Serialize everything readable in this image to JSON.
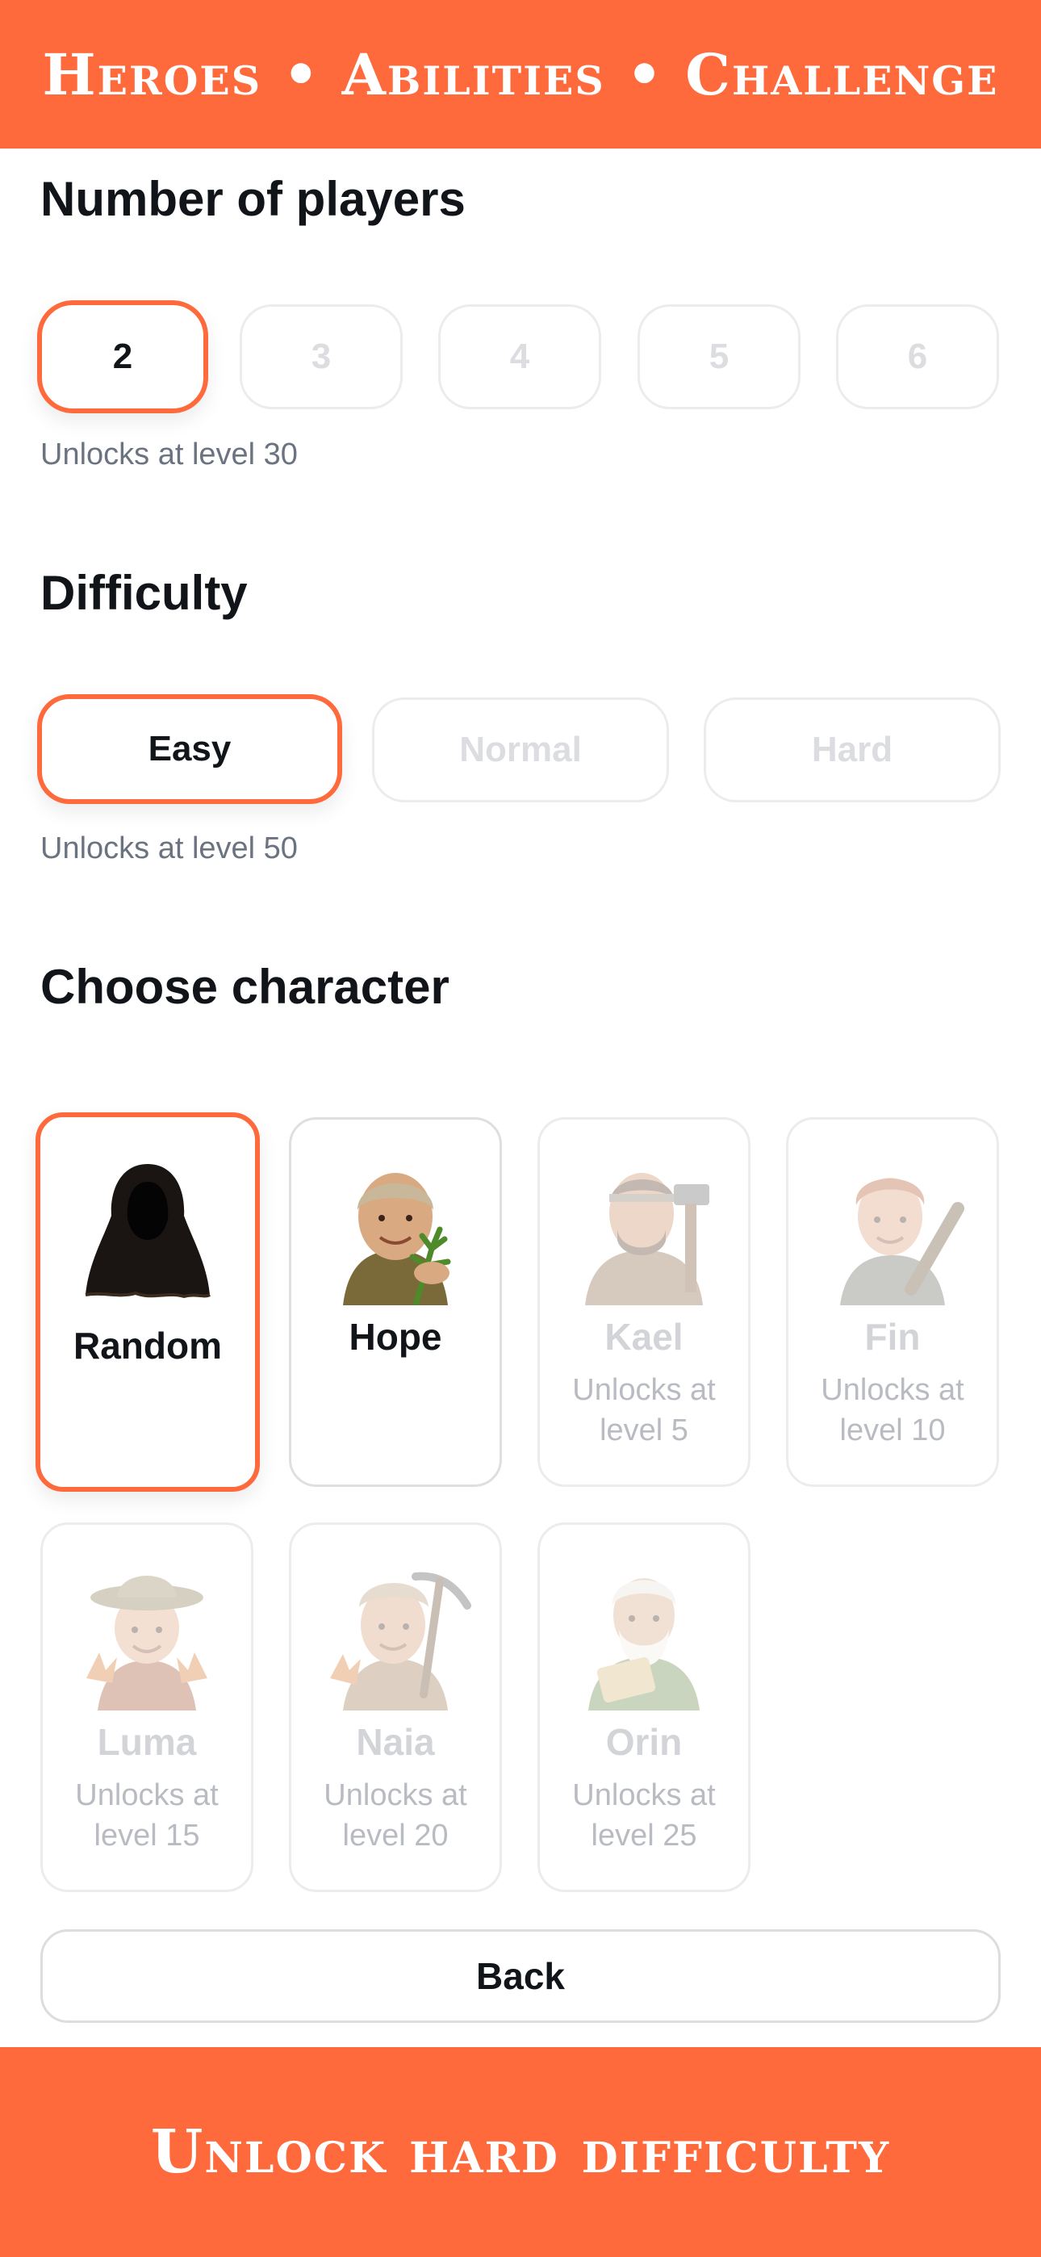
{
  "header": {
    "title": "Heroes • Abilities • Challenge"
  },
  "players": {
    "title": "Number of players",
    "options": [
      "2",
      "3",
      "4",
      "5",
      "6"
    ],
    "selected": "2",
    "hint": "Unlocks at level 30"
  },
  "difficulty": {
    "title": "Difficulty",
    "options": [
      "Easy",
      "Normal",
      "Hard"
    ],
    "selected": "Easy",
    "hint": "Unlocks at level 50"
  },
  "character": {
    "title": "Choose character",
    "items": [
      {
        "name": "Random",
        "lock": "",
        "state": "selected",
        "icon": "hooded-figure-icon"
      },
      {
        "name": "Hope",
        "lock": "",
        "state": "available",
        "icon": "old-woman-herbs-portrait"
      },
      {
        "name": "Kael",
        "lock": "Unlocks at level 5",
        "state": "locked",
        "icon": "man-hammer-portrait"
      },
      {
        "name": "Fin",
        "lock": "Unlocks at level 10",
        "state": "locked",
        "icon": "boy-club-portrait"
      },
      {
        "name": "Luma",
        "lock": "Unlocks at level 15",
        "state": "locked",
        "icon": "girl-leaves-portrait"
      },
      {
        "name": "Naia",
        "lock": "Unlocks at level 20",
        "state": "locked",
        "icon": "woman-pickaxe-portrait"
      },
      {
        "name": "Orin",
        "lock": "Unlocks at level 25",
        "state": "locked",
        "icon": "old-man-scroll-portrait"
      }
    ]
  },
  "back_label": "Back",
  "footer": {
    "text": "Unlock hard difficulty"
  },
  "colors": {
    "accent": "#ff6a3c",
    "text": "#111418",
    "muted": "#6b7380",
    "disabled": "#dcdde0"
  }
}
